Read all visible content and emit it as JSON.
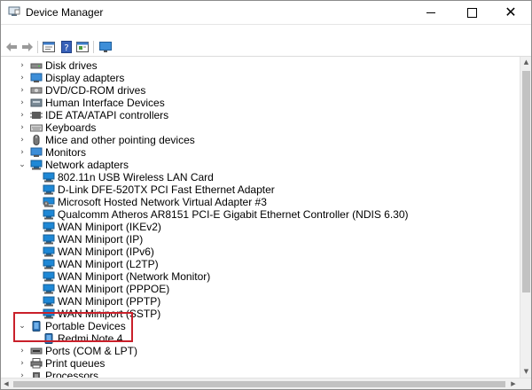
{
  "window": {
    "title": "Device Manager",
    "app_icon": "device-manager-icon"
  },
  "toolbar": {
    "buttons": [
      "back-arrow-icon",
      "forward-arrow-icon",
      "properties-icon",
      "help-icon",
      "update-driver-icon",
      "scan-monitor-icon"
    ]
  },
  "tree": {
    "disk_drives": "Disk drives",
    "display_adapters": "Display adapters",
    "dvd_drives": "DVD/CD-ROM drives",
    "hid": "Human Interface Devices",
    "ide": "IDE ATA/ATAPI controllers",
    "keyboards": "Keyboards",
    "mice": "Mice and other pointing devices",
    "monitors": "Monitors",
    "network_adapters": "Network adapters",
    "network_children": [
      "802.11n USB Wireless LAN Card",
      "D-Link DFE-520TX PCI Fast Ethernet Adapter",
      "Microsoft Hosted Network Virtual Adapter #3",
      "Qualcomm Atheros AR8151 PCI-E Gigabit Ethernet Controller (NDIS 6.30)",
      "WAN Miniport (IKEv2)",
      "WAN Miniport (IP)",
      "WAN Miniport (IPv6)",
      "WAN Miniport (L2TP)",
      "WAN Miniport (Network Monitor)",
      "WAN Miniport (PPPOE)",
      "WAN Miniport (PPTP)",
      "WAN Miniport (SSTP)"
    ],
    "portable_devices": "Portable Devices",
    "redmi": "Redmi Note 4",
    "ports": "Ports (COM & LPT)",
    "print_queues": "Print queues",
    "processors": "Processors"
  },
  "colors": {
    "highlight": "#c9202a",
    "net_icon": "#1e88d6"
  }
}
